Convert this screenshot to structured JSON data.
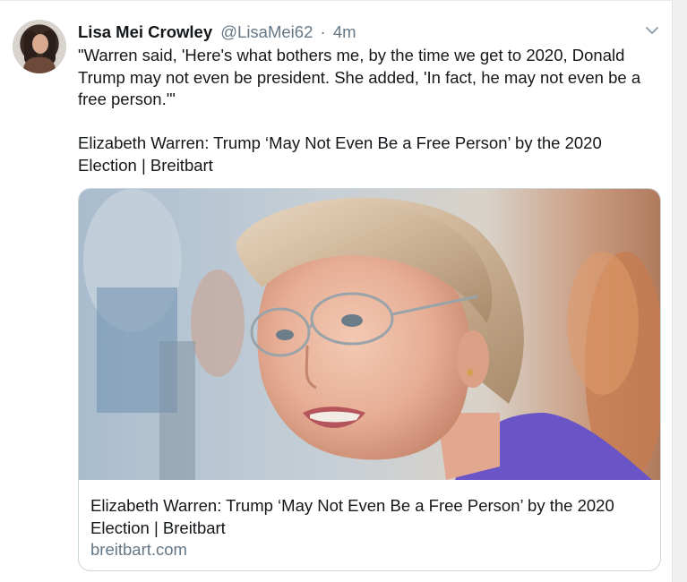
{
  "tweet": {
    "author_name": "Lisa Mei Crowley",
    "author_handle": "@LisaMei62",
    "separator": "·",
    "time": "4m",
    "text": "\"Warren said, 'Here's what bothers me, by the time we get to 2020, Donald Trump may not even be president. She added, 'In fact, he may not even be a free person.'\"\n\nElizabeth Warren: Trump ‘May Not Even Be a Free Person’ by the 2020 Election | Breitbart",
    "icons": {
      "avatar": "profile-photo",
      "caret": "chevron-down-icon"
    }
  },
  "card": {
    "title": "Elizabeth Warren: Trump ‘May Not Even Be a Free Person’ by the 2020 Election | Breitbart",
    "domain": "breitbart.com",
    "image": "photo-of-woman-with-glasses"
  },
  "colors": {
    "text": "#14171a",
    "secondary": "#657786",
    "border": "#ccd6dd"
  }
}
